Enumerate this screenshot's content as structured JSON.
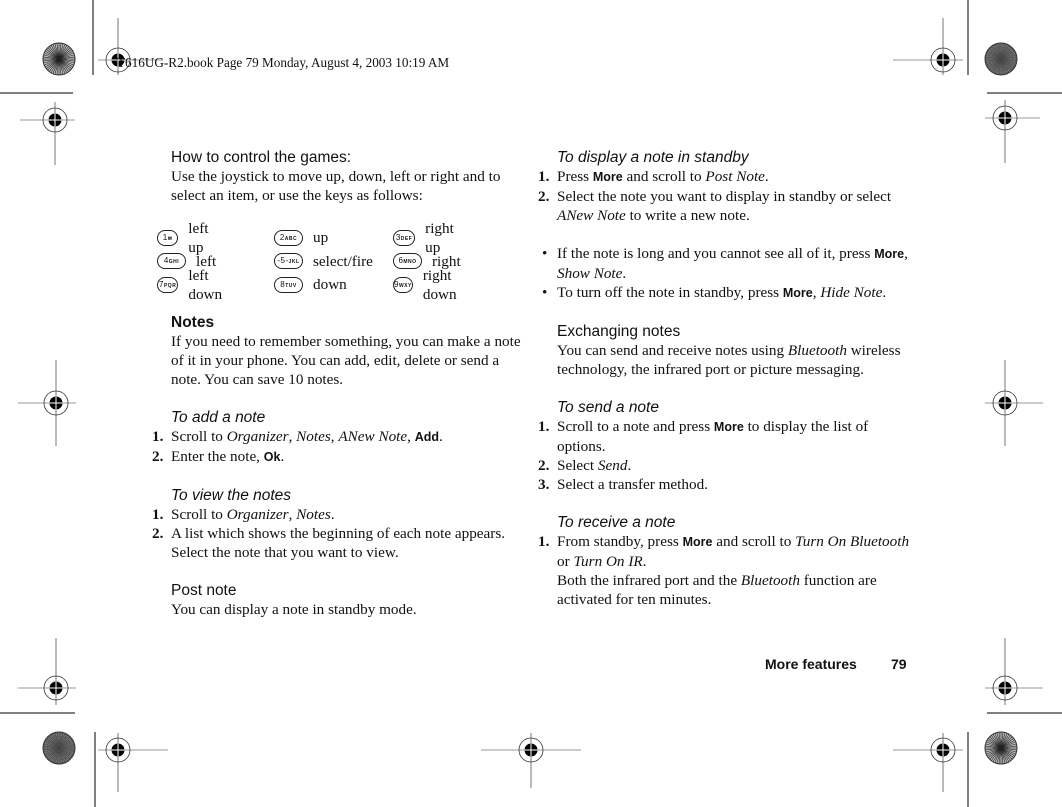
{
  "header": {
    "text": "T616UG-R2.book  Page 79  Monday, August 4, 2003  10:19 AM"
  },
  "left_column": {
    "games": {
      "heading": "How to control the games:",
      "body": "Use the joystick to move up, down, left or right and to select an item, or use the keys as follows:",
      "keys": [
        {
          "key": "1",
          "sub": "✉",
          "action": "left up"
        },
        {
          "key": "2",
          "sub": "ABC",
          "action": "up"
        },
        {
          "key": "3",
          "sub": "DEF",
          "action": "right up"
        },
        {
          "key": "4",
          "sub": "GHI",
          "action": "left"
        },
        {
          "key": "-5-",
          "sub": "JKL",
          "action": "select/fire"
        },
        {
          "key": "6",
          "sub": "MNO",
          "action": "right"
        },
        {
          "key": "7",
          "sub": "PQRS",
          "action": "left down"
        },
        {
          "key": "8",
          "sub": "TUV",
          "action": "down"
        },
        {
          "key": "9",
          "sub": "WXYZ",
          "action": "right down"
        }
      ]
    },
    "notes": {
      "heading": "Notes",
      "body": "If you need to remember something, you can make a note of it in your phone. You can add, edit, delete or send a note. You can save 10 notes."
    },
    "add_note": {
      "heading": "To add a note",
      "steps": [
        {
          "num": "1.",
          "parts": [
            [
              "t",
              "Scroll to "
            ],
            [
              "i",
              "Organizer"
            ],
            [
              "t",
              ", "
            ],
            [
              "i",
              "Notes"
            ],
            [
              "t",
              ", "
            ],
            [
              "i",
              "ANew Note"
            ],
            [
              "t",
              ", "
            ],
            [
              "b",
              "Add"
            ],
            [
              "t",
              "."
            ]
          ]
        },
        {
          "num": "2.",
          "parts": [
            [
              "t",
              "Enter the note, "
            ],
            [
              "b",
              "Ok"
            ],
            [
              "t",
              "."
            ]
          ]
        }
      ]
    },
    "view_notes": {
      "heading": "To view the notes",
      "steps": [
        {
          "num": "1.",
          "parts": [
            [
              "t",
              "Scroll to "
            ],
            [
              "i",
              "Organizer"
            ],
            [
              "t",
              ", "
            ],
            [
              "i",
              "Notes"
            ],
            [
              "t",
              "."
            ]
          ]
        },
        {
          "num": "2.",
          "parts": [
            [
              "t",
              "A list which shows the beginning of each note appears. Select the note that you want to view."
            ]
          ]
        }
      ]
    },
    "post_note": {
      "heading": "Post note",
      "body": "You can display a note in standby mode."
    }
  },
  "right_column": {
    "display_standby": {
      "heading": "To display a note in standby",
      "steps": [
        {
          "num": "1.",
          "parts": [
            [
              "t",
              "Press "
            ],
            [
              "b",
              "More"
            ],
            [
              "t",
              " and scroll to "
            ],
            [
              "i",
              "Post Note"
            ],
            [
              "t",
              "."
            ]
          ]
        },
        {
          "num": "2.",
          "parts": [
            [
              "t",
              "Select the note you want to display in standby or select "
            ],
            [
              "i",
              "ANew Note"
            ],
            [
              "t",
              " to write a new note."
            ]
          ]
        }
      ],
      "bullets": [
        {
          "parts": [
            [
              "t",
              "If the note is long and you cannot see all of it, press "
            ],
            [
              "b",
              "More"
            ],
            [
              "t",
              ", "
            ],
            [
              "i",
              "Show Note"
            ],
            [
              "t",
              "."
            ]
          ]
        },
        {
          "parts": [
            [
              "t",
              "To turn off the note in standby, press "
            ],
            [
              "b",
              "More"
            ],
            [
              "t",
              ", "
            ],
            [
              "i",
              "Hide Note"
            ],
            [
              "t",
              "."
            ]
          ]
        }
      ]
    },
    "exchanging": {
      "heading": "Exchanging notes",
      "parts": [
        [
          "t",
          "You can send and receive notes using "
        ],
        [
          "i",
          "Bluetooth"
        ],
        [
          "t",
          " wireless technology, the infrared port or picture messaging."
        ]
      ]
    },
    "send_note": {
      "heading": "To send a note",
      "steps": [
        {
          "num": "1.",
          "parts": [
            [
              "t",
              "Scroll to a note and press "
            ],
            [
              "b",
              "More"
            ],
            [
              "t",
              " to display the list of options."
            ]
          ]
        },
        {
          "num": "2.",
          "parts": [
            [
              "t",
              "Select "
            ],
            [
              "i",
              "Send"
            ],
            [
              "t",
              "."
            ]
          ]
        },
        {
          "num": "3.",
          "parts": [
            [
              "t",
              "Select a transfer method."
            ]
          ]
        }
      ]
    },
    "receive_note": {
      "heading": "To receive a note",
      "steps": [
        {
          "num": "1.",
          "parts": [
            [
              "t",
              "From standby, press "
            ],
            [
              "b",
              "More"
            ],
            [
              "t",
              " and scroll to "
            ],
            [
              "i",
              "Turn On Bluetooth"
            ],
            [
              "t",
              " or "
            ],
            [
              "i",
              "Turn On IR"
            ],
            [
              "t",
              "."
            ]
          ]
        }
      ],
      "continuation": [
        [
          "t",
          "Both the infrared port and the "
        ],
        [
          "i",
          "Bluetooth"
        ],
        [
          "t",
          " function are activated for ten minutes."
        ]
      ]
    }
  },
  "footer": {
    "section": "More features",
    "page_number": "79"
  }
}
